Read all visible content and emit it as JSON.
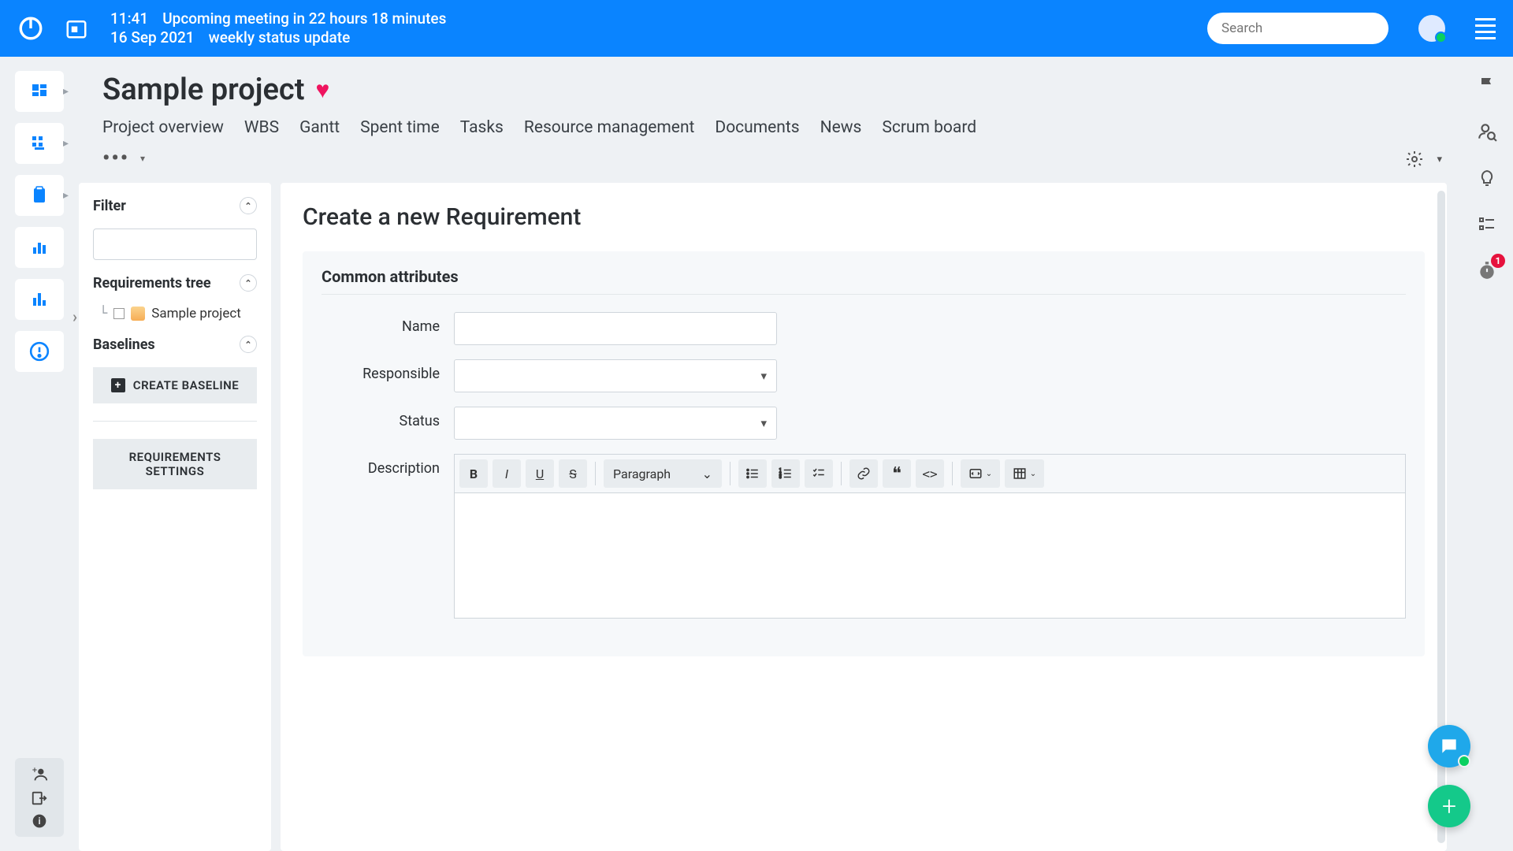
{
  "topbar": {
    "time": "11:41",
    "meeting_notice": "Upcoming meeting in 22 hours 18 minutes",
    "date": "16 Sep 2021",
    "meeting_title": "weekly status update",
    "search_placeholder": "Search"
  },
  "project": {
    "title": "Sample project",
    "tabs": [
      "Project overview",
      "WBS",
      "Gantt",
      "Spent time",
      "Tasks",
      "Resource management",
      "Documents",
      "News",
      "Scrum board"
    ],
    "more_menu": "•••"
  },
  "sidebar": {
    "filter_label": "Filter",
    "tree_label": "Requirements tree",
    "tree_root": "Sample project",
    "baselines_label": "Baselines",
    "create_baseline": "CREATE BASELINE",
    "settings": "REQUIREMENTS SETTINGS"
  },
  "form": {
    "heading": "Create a new Requirement",
    "section": "Common attributes",
    "fields": {
      "name": "Name",
      "responsible": "Responsible",
      "status": "Status",
      "description": "Description"
    },
    "editor": {
      "paragraph": "Paragraph"
    }
  },
  "right_rail": {
    "badge": "1"
  }
}
